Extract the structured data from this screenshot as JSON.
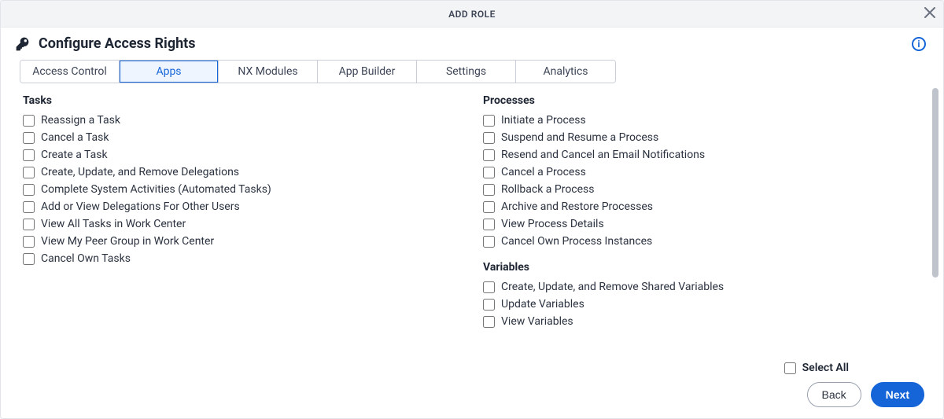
{
  "modal": {
    "title": "ADD ROLE"
  },
  "header": {
    "title": "Configure Access Rights"
  },
  "tabs": [
    {
      "label": "Access Control"
    },
    {
      "label": "Apps"
    },
    {
      "label": "NX Modules"
    },
    {
      "label": "App Builder"
    },
    {
      "label": "Settings"
    },
    {
      "label": "Analytics"
    }
  ],
  "active_tab_index": 1,
  "groups": {
    "tasks": {
      "title": "Tasks",
      "items": [
        "Reassign a Task",
        "Cancel a Task",
        "Create a Task",
        "Create, Update, and Remove Delegations",
        "Complete System Activities (Automated Tasks)",
        "Add or View Delegations For Other Users",
        "View All Tasks in Work Center",
        "View My Peer Group in Work Center",
        "Cancel Own Tasks"
      ]
    },
    "processes": {
      "title": "Processes",
      "items": [
        "Initiate a Process",
        "Suspend and Resume a Process",
        "Resend and Cancel an Email Notifications",
        "Cancel a Process",
        "Rollback a Process",
        "Archive and Restore Processes",
        "View Process Details",
        "Cancel Own Process Instances"
      ]
    },
    "variables": {
      "title": "Variables",
      "items": [
        "Create, Update, and Remove Shared Variables",
        "Update Variables",
        "View Variables"
      ]
    }
  },
  "footer": {
    "select_all_label": "Select All",
    "back_label": "Back",
    "next_label": "Next"
  }
}
